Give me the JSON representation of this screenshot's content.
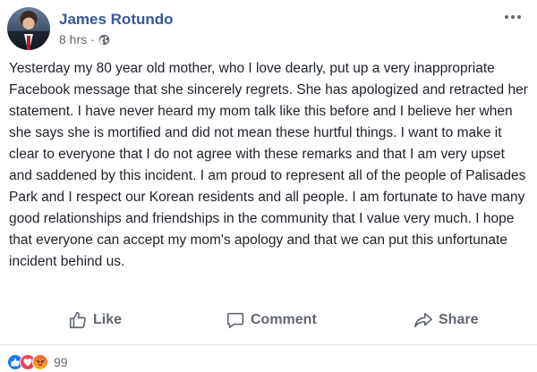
{
  "post": {
    "author": "James Rotundo",
    "time": "8 hrs",
    "separator": "·",
    "privacy_icon": "globe-icon",
    "body": "Yesterday my 80 year old mother, who I love dearly, put up a very inappropriate Facebook message that she sincerely regrets. She has apologized and retracted her statement. I have never heard my mom talk like this before and I believe her when she says she is mortified and did not mean these hurtful things. I want to make it clear to everyone that I do not agree with these remarks and that I am very upset and saddened by this incident. I am proud to represent all of the people of Palisades Park and I respect our Korean residents and all people. I am fortunate to have many good relationships and friendships in the community that I value very much. I hope that everyone can accept my mom's apology and that we can put this unfortunate incident behind us."
  },
  "actions": {
    "like_label": "Like",
    "comment_label": "Comment",
    "share_label": "Share"
  },
  "reactions": {
    "types": [
      "like",
      "love",
      "angry"
    ],
    "count": "99"
  },
  "colors": {
    "author": "#365899",
    "muted": "#606770",
    "like": "#1877f2",
    "love": "#f33e58"
  }
}
